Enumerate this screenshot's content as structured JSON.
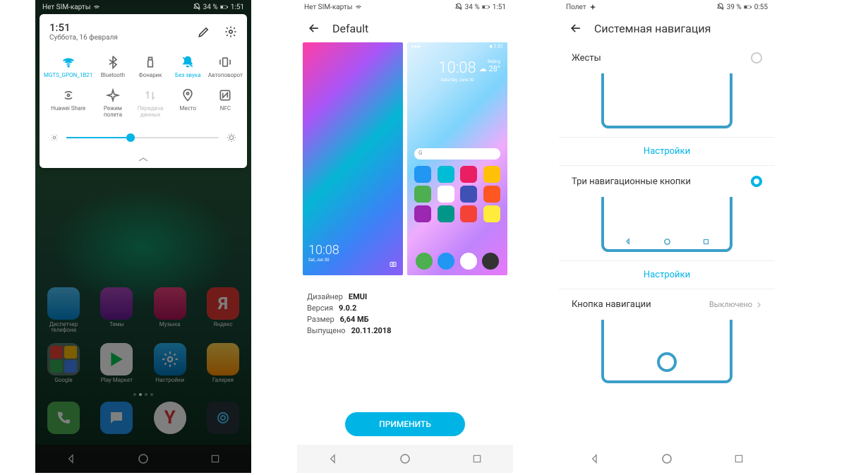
{
  "phone1": {
    "status": {
      "left": "Нет SIM-карты",
      "right": "34 %",
      "time": "1:51"
    },
    "qs": {
      "time": "1:51",
      "date": "Суббота, 16 февраля",
      "tiles": [
        {
          "label": "MGTS_GPON_1B21",
          "active": true
        },
        {
          "label": "Bluetooth"
        },
        {
          "label": "Фонарик"
        },
        {
          "label": "Без звука",
          "active": true
        },
        {
          "label": "Автоповорот"
        },
        {
          "label": "Huawei Share"
        },
        {
          "label": "Режим полета"
        },
        {
          "label": "Передача данных",
          "disabled": true
        },
        {
          "label": "Место"
        },
        {
          "label": "NFC"
        }
      ],
      "brightness": 42
    },
    "home": {
      "row1": [
        "Диспетчер телефона",
        "Темы",
        "Музыка",
        "Яндекс"
      ],
      "row2": [
        "Google",
        "Play Маркет",
        "Настройки",
        "Галерея"
      ]
    }
  },
  "phone2": {
    "status": {
      "left": "Нет SIM-карты",
      "right": "34 %",
      "time": "1:51"
    },
    "title": "Default",
    "info": {
      "designer_label": "Дизайнер",
      "designer": "EMUI",
      "version_label": "Версия",
      "version": "9.0.2",
      "size_label": "Размер",
      "size": "6,64 МБ",
      "released_label": "Выпущено",
      "released": "20.11.2018"
    },
    "preview": {
      "time": "10:08",
      "date2": "Saturday, June 30",
      "date3": "Sat, Jun 30",
      "city": "Beijing",
      "temp": "28°"
    },
    "apply": "ПРИМЕНИТЬ"
  },
  "phone3": {
    "status": {
      "left": "Полет",
      "right": "39 %",
      "time": "0:55"
    },
    "title": "Системная навигация",
    "gestures": "Жесты",
    "three_key": "Три навигационные кнопки",
    "nav_dock": "Кнопка навигации",
    "nav_dock_status": "Выключено",
    "settings": "Настройки"
  }
}
